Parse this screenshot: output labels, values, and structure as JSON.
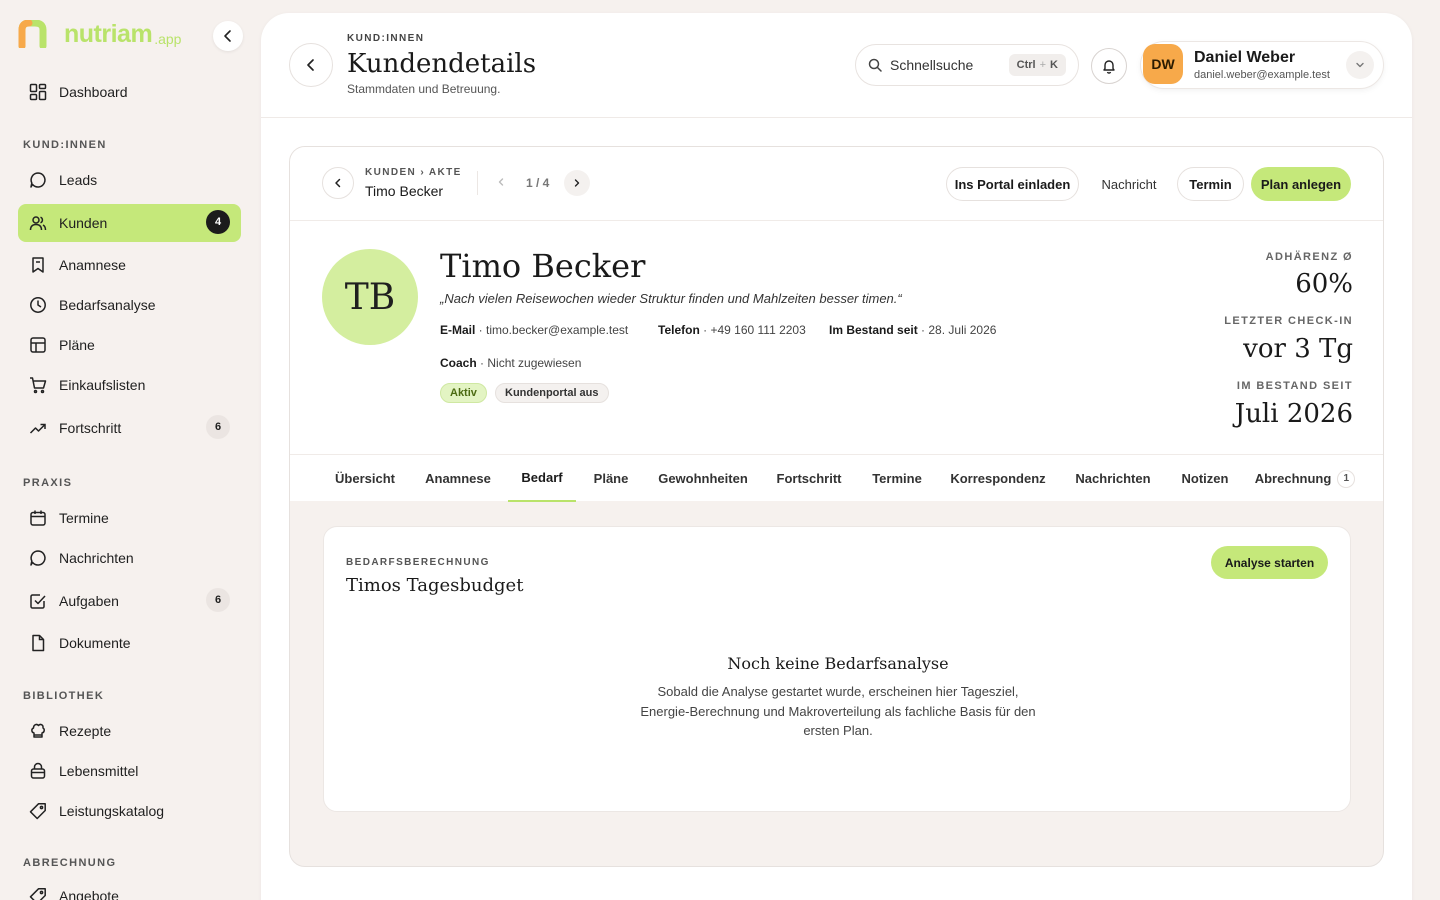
{
  "brand": {
    "name": "nutriam",
    "suffix": ".app",
    "color": "#b9e36a"
  },
  "sidebar": {
    "dashboard": "Dashboard",
    "sections": {
      "kunden": "KUND:INNEN",
      "praxis": "PRAXIS",
      "bibliothek": "BIBLIOTHEK",
      "abrechnung": "ABRECHNUNG"
    },
    "items": {
      "leads": "Leads",
      "kunden": "Kunden",
      "kunden_badge": "4",
      "anamnese": "Anamnese",
      "bedarfsanalyse": "Bedarfsanalyse",
      "plaene": "Pläne",
      "einkaufslisten": "Einkaufslisten",
      "fortschritt": "Fortschritt",
      "fortschritt_badge": "6",
      "termine": "Termine",
      "nachrichten": "Nachrichten",
      "aufgaben": "Aufgaben",
      "aufgaben_badge": "6",
      "dokumente": "Dokumente",
      "rezepte": "Rezepte",
      "lebensmittel": "Lebensmittel",
      "leistungskatalog": "Leistungskatalog",
      "angebote": "Angebote"
    }
  },
  "header": {
    "eyebrow": "KUND:INNEN",
    "title": "Kundendetails",
    "subtitle": "Stammdaten und Betreuung.",
    "search_placeholder": "Schnellsuche",
    "shortcut_ctrl": "Ctrl",
    "shortcut_plus": "+",
    "shortcut_key": "K"
  },
  "user": {
    "initials": "DW",
    "name": "Daniel Weber",
    "email": "daniel.weber@example.test"
  },
  "subnav": {
    "breadcrumb": "KUNDEN › AKTE",
    "name": "Timo Becker",
    "pager": "1 / 4",
    "actions": {
      "invite": "Ins Portal einladen",
      "message": "Nachricht",
      "appointment": "Termin",
      "plan": "Plan anlegen"
    }
  },
  "customer": {
    "initials": "TB",
    "name": "Timo Becker",
    "quote": "„Nach vielen Reisewochen wieder Struktur finden und Mahlzeiten besser timen.“",
    "email_label": "E-Mail",
    "email": "timo.becker@example.test",
    "phone_label": "Telefon",
    "phone": "+49 160 111 2203",
    "since_label": "Im Bestand seit",
    "since": "28. Juli 2026",
    "coach_label": "Coach",
    "coach": "Nicht zugewiesen",
    "sep": " · ",
    "status_chip": "Aktiv",
    "portal_chip": "Kundenportal aus"
  },
  "stats": {
    "adherence_label": "ADHÄRENZ Ø",
    "adherence": "60%",
    "checkin_label": "LETZTER CHECK-IN",
    "checkin": "vor 3 Tg",
    "since_label": "IM BESTAND SEIT",
    "since": "Juli 2026"
  },
  "tabs": {
    "uebersicht": "Übersicht",
    "anamnese": "Anamnese",
    "bedarf": "Bedarf",
    "plaene": "Pläne",
    "gewohnheiten": "Gewohnheiten",
    "fortschritt": "Fortschritt",
    "termine": "Termine",
    "korrespondenz": "Korrespondenz",
    "nachrichten": "Nachrichten",
    "notizen": "Notizen",
    "abrechnung": "Abrechnung",
    "abrechnung_badge": "1"
  },
  "panel": {
    "eyebrow": "BEDARFSBERECHNUNG",
    "title": "Timos Tagesbudget",
    "button": "Analyse starten",
    "empty_title": "Noch keine Bedarfsanalyse",
    "empty_text": "Sobald die Analyse gestartet wurde, erscheinen hier Tagesziel, Energie-Berechnung und Makroverteilung als fachliche Basis für den ersten Plan."
  },
  "colors": {
    "accent": "#c5e87a",
    "avatar_customer": "#d4ee9f",
    "avatar_user": "#f7a94a"
  }
}
